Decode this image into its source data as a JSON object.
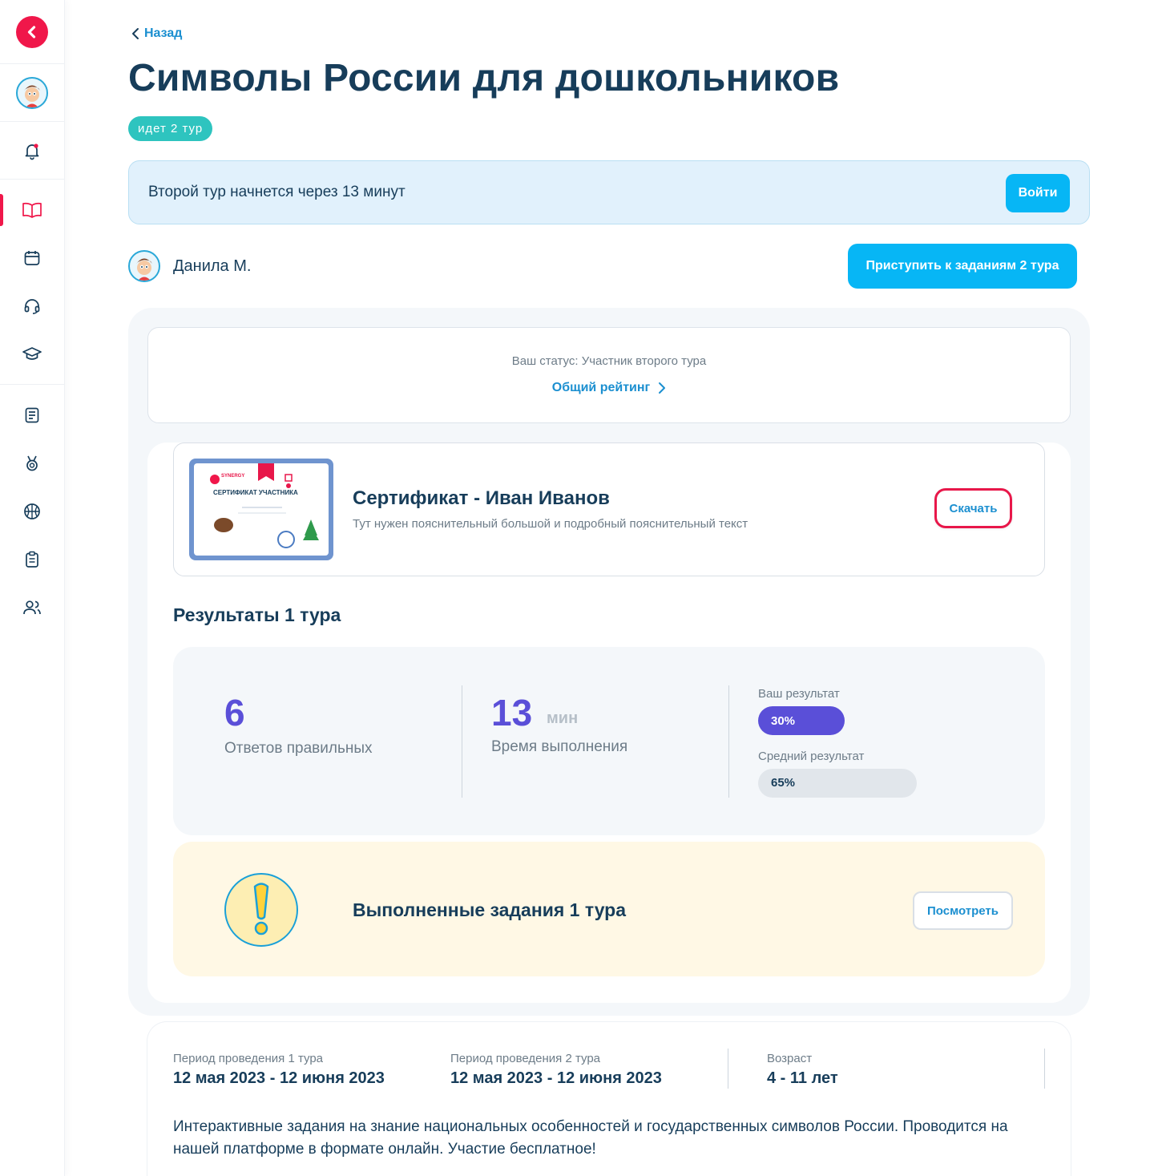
{
  "nav": {
    "back_label": "Назад"
  },
  "page": {
    "title": "Символы России для дошкольников",
    "badge": "идет 2 тур"
  },
  "notice": {
    "text": "Второй тур начнется через 13 минут",
    "button": "Войти"
  },
  "user": {
    "name": "Данила М.",
    "start_button": "Приступить к заданиям 2 тура"
  },
  "status": {
    "text": "Ваш статус: Участник второго тура",
    "rating_link": "Общий рейтинг"
  },
  "certificate": {
    "title": "Сертификат - Иван Иванов",
    "description": "Тут нужен пояснительный большой и подробный пояснительный текст",
    "download_button": "Скачать",
    "thumb_heading": "СЕРТИФИКАТ УЧАСТНИКА",
    "thumb_brand": "SYNERGY"
  },
  "results": {
    "title": "Результаты 1 тура",
    "correct_value": "6",
    "correct_label": "Ответов правильных",
    "time_value": "13",
    "time_unit": "мин",
    "time_label": "Время выполнения",
    "your_result_label": "Ваш результат",
    "your_result_value": "30%",
    "your_result_fraction": 0.3,
    "avg_result_label": "Средний результат",
    "avg_result_value": "65%",
    "avg_result_fraction": 0.65
  },
  "tasks": {
    "title": "Выполненные задания 1 тура",
    "button": "Посмотреть"
  },
  "info": {
    "period1_label": "Период проведения 1 тура",
    "period1_value": "12 мая 2023 - 12 июня 2023",
    "period2_label": "Период проведения 2 тура",
    "period2_value": "12 мая 2023 - 12 июня 2023",
    "age_label": "Возраст",
    "age_value": "4 - 11 лет",
    "description": "Интерактивные задания на знание национальных особенностей и государственных символов России. Проводится на нашей платформе в формате онлайн. Участие бесплатное!"
  },
  "colors": {
    "accent": "#07b6f5",
    "brand_red": "#f0174a",
    "badge": "#2ec4bf",
    "progress": "#5a4fd8",
    "title": "#173d5a"
  },
  "sidebar_icons": [
    "back-icon",
    "avatar",
    "bell-icon",
    "book-icon",
    "calendar-icon",
    "headset-icon",
    "graduation-cap-icon",
    "notebook-icon",
    "medal-icon",
    "basketball-icon",
    "clipboard-icon",
    "users-icon"
  ]
}
